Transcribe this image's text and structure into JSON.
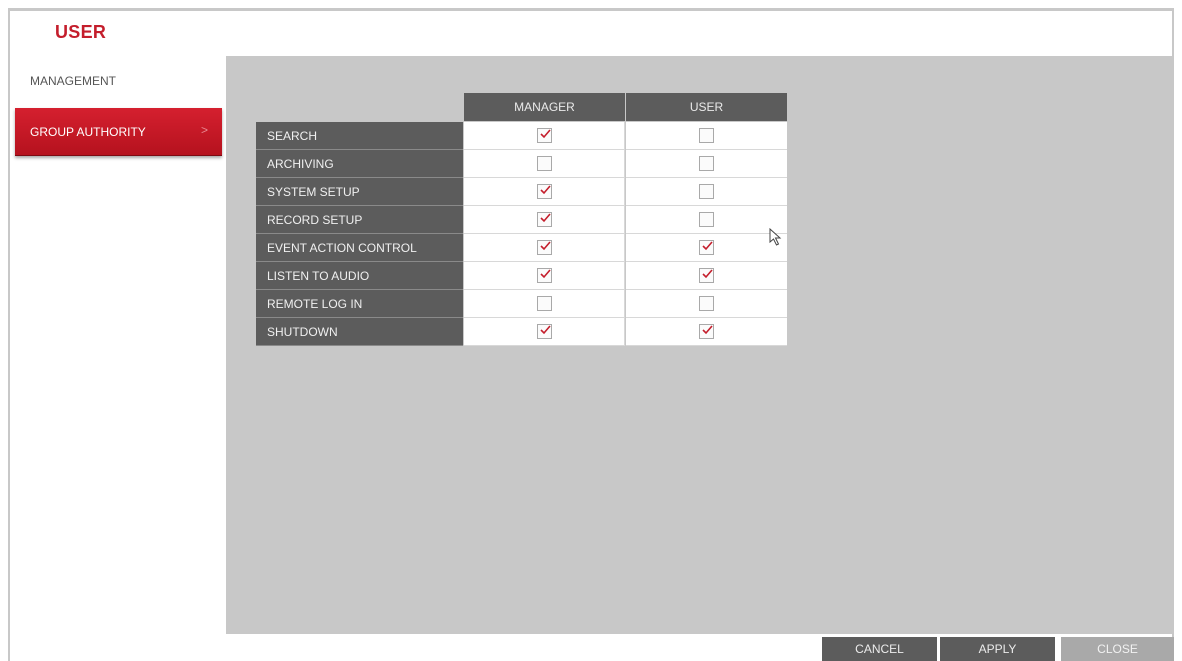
{
  "window": {
    "title": "USER"
  },
  "sidebar": {
    "items": [
      {
        "label": "MANAGEMENT",
        "active": false
      },
      {
        "label": "GROUP AUTHORITY",
        "active": true,
        "chevron": ">"
      }
    ]
  },
  "table": {
    "columns": [
      "MANAGER",
      "USER"
    ],
    "rows": [
      {
        "label": "SEARCH",
        "manager": true,
        "user": false
      },
      {
        "label": "ARCHIVING",
        "manager": false,
        "user": false
      },
      {
        "label": "SYSTEM SETUP",
        "manager": true,
        "user": false
      },
      {
        "label": "RECORD SETUP",
        "manager": true,
        "user": false
      },
      {
        "label": "EVENT ACTION CONTROL",
        "manager": true,
        "user": true
      },
      {
        "label": "LISTEN TO AUDIO",
        "manager": true,
        "user": true
      },
      {
        "label": "REMOTE LOG IN",
        "manager": false,
        "user": false
      },
      {
        "label": "SHUTDOWN",
        "manager": true,
        "user": true
      }
    ]
  },
  "footer": {
    "cancel_label": "CANCEL",
    "apply_label": "APPLY",
    "close_label": "CLOSE"
  },
  "colors": {
    "accent": "#c41e2c",
    "header_gray": "#5c5c5c",
    "panel_gray": "#c8c8c8",
    "check_red": "#c41e2c"
  }
}
